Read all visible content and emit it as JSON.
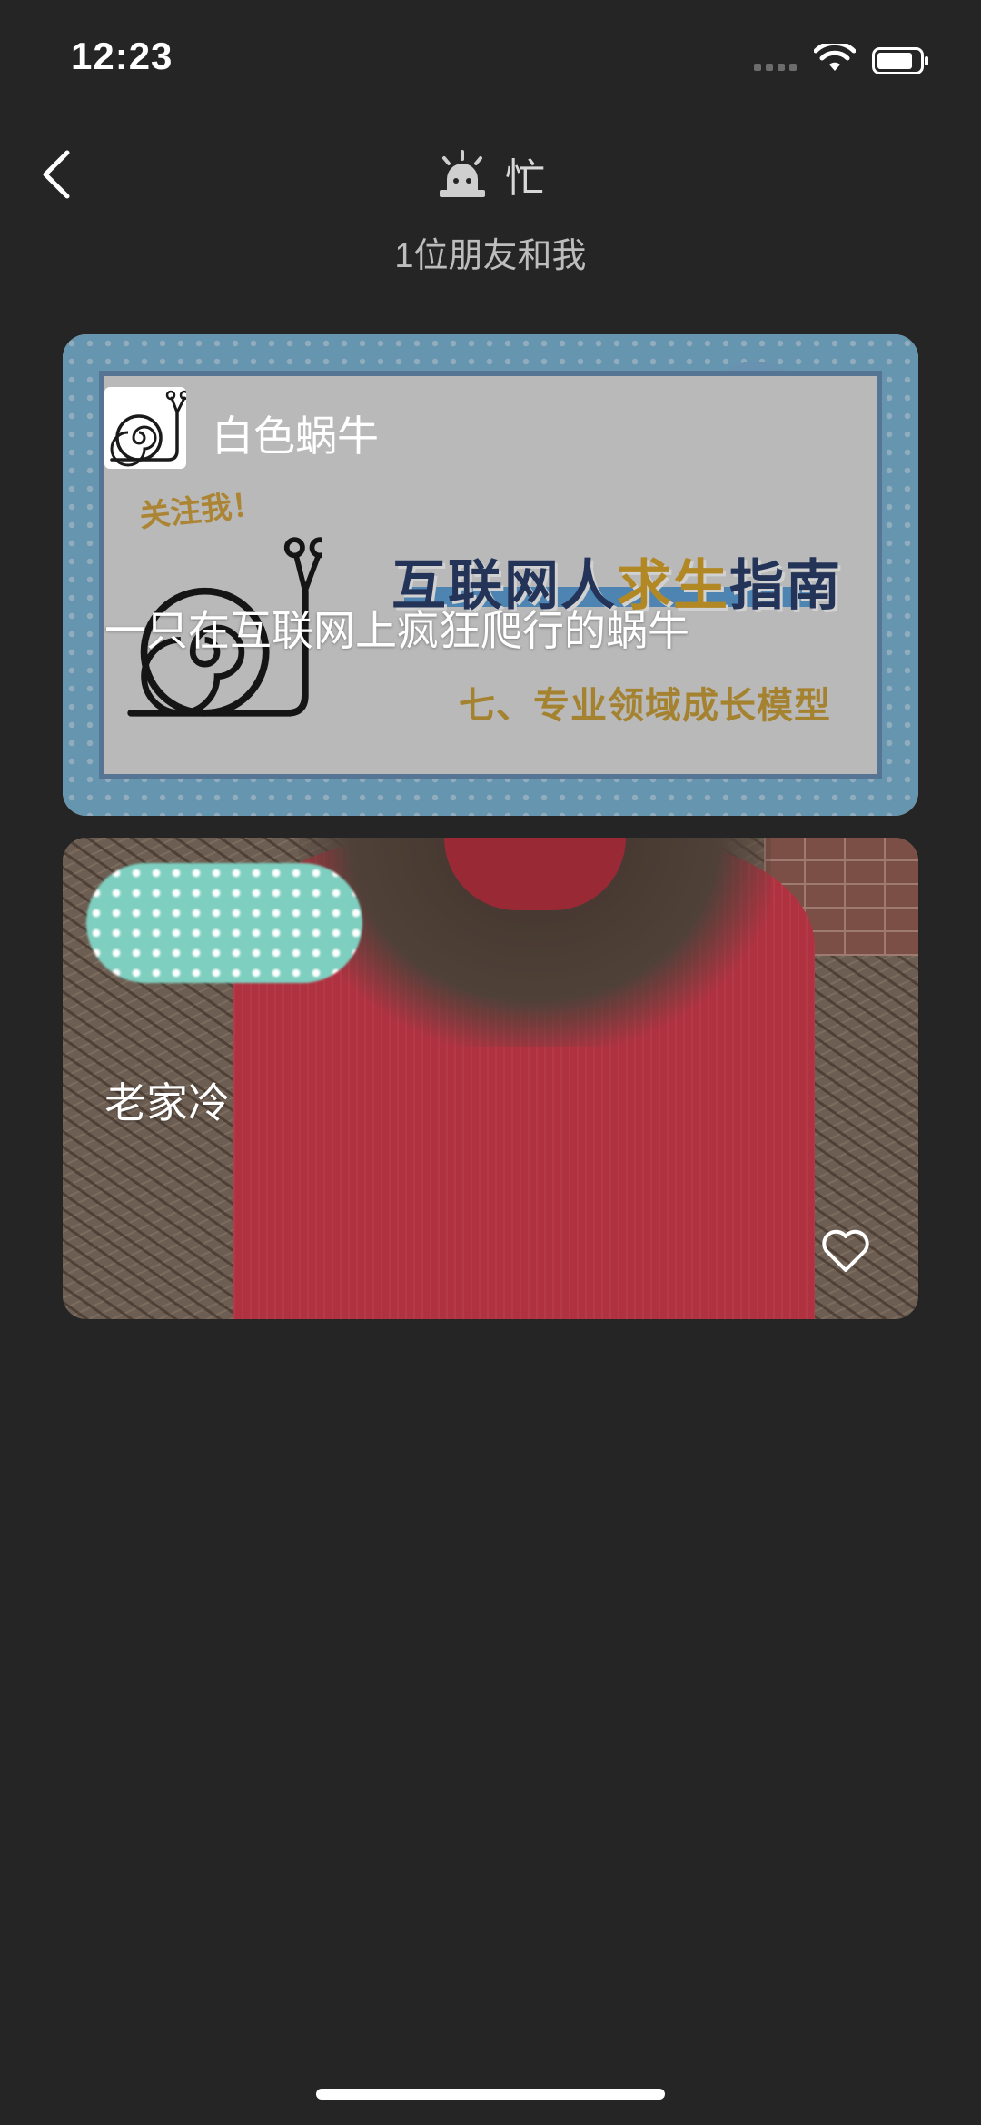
{
  "status_bar": {
    "time": "12:23",
    "icons": [
      "signal-icon",
      "wifi-icon",
      "battery-icon"
    ]
  },
  "header": {
    "back_icon": "chevron-left-icon",
    "status_icon": "alarm-light-icon",
    "title": "忙",
    "subtitle": "1位朋友和我"
  },
  "cards": [
    {
      "name": "白色蜗牛",
      "text": "一只在互联网上疯狂爬行的蜗牛",
      "avatar_icon": "snail-icon",
      "image_text": {
        "tag": "关注我！",
        "headline_part1": "互联网人",
        "headline_highlight": "求生",
        "headline_part2": "指南",
        "sub": "七、专业领域成长模型"
      }
    },
    {
      "text": "老家冷",
      "like_icon": "heart-outline-icon"
    }
  ],
  "colors": {
    "background": "#252525",
    "text": "#ffffff",
    "subtitle": "#bdbdbd"
  }
}
